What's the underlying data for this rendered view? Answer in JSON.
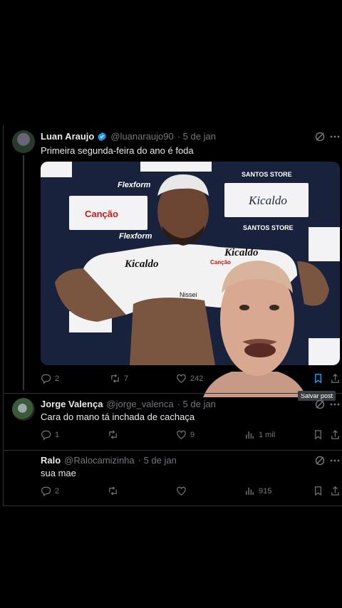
{
  "tweet": {
    "author_name": "Luan Araujo",
    "handle": "@luanaraujo90",
    "date": "· 5 de jan",
    "text": "Primeira segunda-feira do ano é foda",
    "replies": "2",
    "retweets": "7",
    "likes": "242",
    "media_texts": {
      "sponsor1": "Kicaldo",
      "sponsor2": "Canção",
      "sponsor3": "Flexform",
      "sponsor4": "SANTOS STORE",
      "shirt_brand": "Kicaldo",
      "shirt_sponsor": "Nissei",
      "shirt_sponsor2": "Canção"
    }
  },
  "tooltip": "Salvar post",
  "replies": [
    {
      "author_name": "Jorge Valença",
      "handle": "@jorge_valenca",
      "date": "· 5 de jan",
      "text": "Cara do mano tá inchada de cachaça",
      "replies": "1",
      "retweets": "",
      "likes": "9",
      "views": "1 mil"
    },
    {
      "author_name": "Ralo",
      "handle": "@Ralocamizinha",
      "date": "· 5 de jan",
      "text": "sua mae",
      "replies": "2",
      "retweets": "",
      "likes": "",
      "views": "915"
    }
  ],
  "colors": {
    "background": "#000000",
    "text": "#e7e9ea",
    "muted": "#71767b",
    "verified": "#1d9bf0",
    "divider": "#2f3336"
  }
}
